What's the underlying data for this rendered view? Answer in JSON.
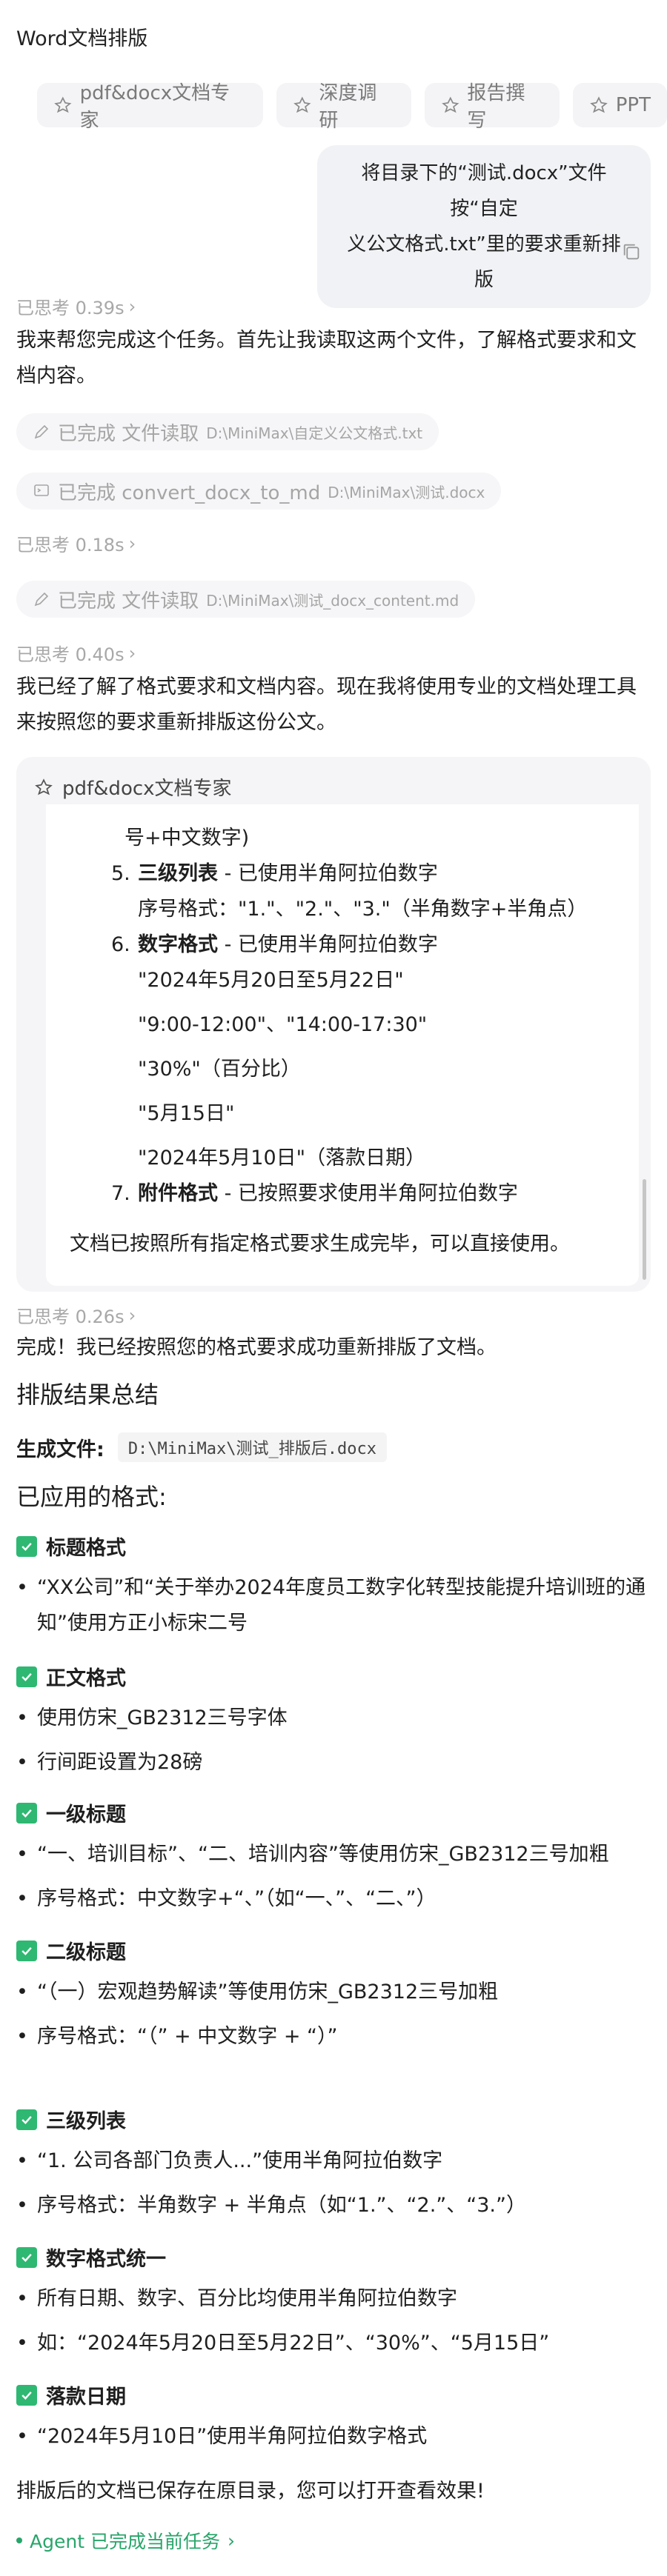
{
  "app_title": "Word文档排版",
  "chips": [
    {
      "label": "pdf&docx文档专家",
      "icon": "agent-icon"
    },
    {
      "label": "深度调研",
      "icon": "agent-icon"
    },
    {
      "label": "报告撰写",
      "icon": "agent-icon"
    },
    {
      "label": "PPT",
      "icon": "agent-icon"
    }
  ],
  "user_message": {
    "line1": "将目录下的“测试.docx”文件按“自定",
    "line2": "义公文格式.txt”里的要求重新排版"
  },
  "thought_1": "已思考 0.39s",
  "reply_1": "我来帮您完成这个任务。首先让我读取这两个文件，了解格式要求和文档内容。",
  "tool_1": {
    "status": "已完成 文件读取",
    "path": "D:\\MiniMax\\自定义公文格式.txt"
  },
  "tool_2": {
    "status": "已完成 convert_docx_to_md",
    "path": "D:\\MiniMax\\测试.docx"
  },
  "thought_2": "已思考 0.18s",
  "tool_3": {
    "status": "已完成 文件读取",
    "path": "D:\\MiniMax\\测试_docx_content.md"
  },
  "thought_3": "已思考 0.40s",
  "reply_2": "我已经了解了格式要求和文档内容。现在我将使用专业的文档处理工具来按照您的要求重新排版这份公文。",
  "panel": {
    "title": "pdf&docx文档专家",
    "cut_line": "号+中文数字)",
    "item5_num": "5.",
    "item5_bold": "三级列表",
    "item5_rest": " - 已使用半角阿拉伯数字",
    "item5_sub": "序号格式：\"1.\"、\"2.\"、\"3.\"（半角数字+半角点）",
    "item6_num": "6.",
    "item6_bold": "数字格式",
    "item6_rest": " - 已使用半角阿拉伯数字",
    "item6_subs": [
      "\"2024年5月20日至5月22日\"",
      "\"9:00-12:00\"、\"14:00-17:30\"",
      "\"30%\"（百分比）",
      "\"5月15日\"",
      "\"2024年5月10日\"（落款日期）"
    ],
    "item7_num": "7.",
    "item7_bold": "附件格式",
    "item7_rest": " - 已按照要求使用半角阿拉伯数字",
    "closing": "文档已按照所有指定格式要求生成完毕，可以直接使用。"
  },
  "thought_4": "已思考 0.26s",
  "reply_3": "完成！我已经按照您的格式要求成功重新排版了文档。",
  "summary_title": "排版结果总结",
  "generated_label": "生成文件:",
  "generated_path": "D:\\MiniMax\\测试_排版后.docx",
  "applied_title": "已应用的格式:",
  "sections": [
    {
      "title": "标题格式",
      "bullets": [
        "“XX公司”和“关于举办2024年度员工数字化转型技能提升培训班的通知”使用方正小标宋二号"
      ]
    },
    {
      "title": "正文格式",
      "bullets": [
        "使用仿宋_GB2312三号字体",
        "行间距设置为28磅"
      ]
    },
    {
      "title": "一级标题",
      "bullets": [
        "“一、培训目标”、“二、培训内容”等使用仿宋_GB2312三号加粗",
        "序号格式：中文数字+“、”（如“一、”、“二、”）"
      ]
    },
    {
      "title": "二级标题",
      "bullets": [
        "“（一）宏观趋势解读”等使用仿宋_GB2312三号加粗",
        "序号格式：“（” + 中文数字 + “）”"
      ]
    },
    {
      "title": "三级列表",
      "bullets": [
        "“1. 公司各部门负责人...”使用半角阿拉伯数字",
        "序号格式：半角数字 + 半角点（如“1.”、“2.”、“3.”）"
      ]
    },
    {
      "title": "数字格式统一",
      "bullets": [
        "所有日期、数字、百分比均使用半角阿拉伯数字",
        "如：“2024年5月20日至5月22日”、“30%”、“5月15日”"
      ]
    },
    {
      "title": "落款日期",
      "bullets": [
        "“2024年5月10日”使用半角阿拉伯数字格式"
      ]
    }
  ],
  "final_note": "排版后的文档已保存在原目录，您可以打开查看效果!",
  "agent_status": "Agent 已完成当前任务",
  "colors": {
    "accent_green": "#2eb872",
    "status_green": "#28a56a"
  }
}
